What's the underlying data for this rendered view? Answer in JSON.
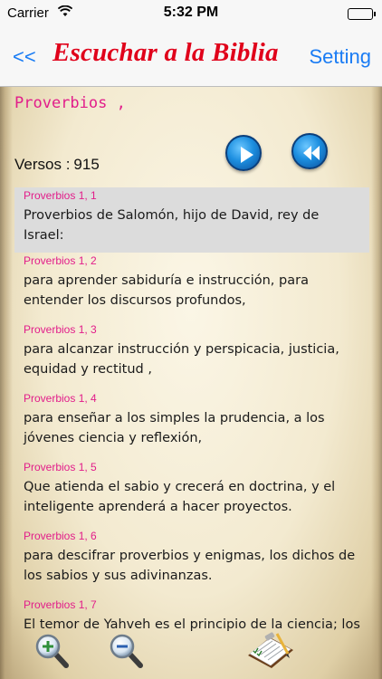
{
  "status_bar": {
    "carrier": "Carrier",
    "wifi_icon": "wifi-icon",
    "time": "5:32 PM",
    "battery_icon": "battery-icon"
  },
  "nav": {
    "back_label": "<<",
    "title": "Escuchar a la Biblia",
    "setting_label": "Setting"
  },
  "colors": {
    "accent_blue": "#1a7cf4",
    "title_red": "#e0001a",
    "reference_pink": "#e21d8a"
  },
  "book_title": "Proverbios ,",
  "versos": {
    "label": "Versos :",
    "count": "915"
  },
  "controls": {
    "play_icon": "play-icon",
    "rewind_icon": "rewind-icon"
  },
  "verses": [
    {
      "ref": "Proverbios 1, 1",
      "text": "Proverbios de Salomón, hijo de David, rey de Israel:",
      "selected": true
    },
    {
      "ref": "Proverbios 1, 2",
      "text": "para aprender sabiduría e instrucción, para entender los discursos profundos,"
    },
    {
      "ref": "Proverbios 1, 3",
      "text": "para alcanzar instrucción y perspicacia,  justicia, equidad y rectitud ,"
    },
    {
      "ref": "Proverbios 1, 4",
      "text": "para enseñar a los simples la prudencia, a los jóvenes ciencia y reflexión,"
    },
    {
      "ref": "Proverbios 1, 5",
      "text": "Que atienda el sabio y crecerá en doctrina, y el inteligente aprenderá a hacer proyectos."
    },
    {
      "ref": "Proverbios 1, 6",
      "text": "para descifrar proverbios y enigmas, los dichos de los sabios y sus adivinanzas."
    },
    {
      "ref": "Proverbios 1, 7",
      "text": "El temor de Yahveh es el principio de la ciencia; los"
    }
  ],
  "toolbar": {
    "zoom_in_icon": "zoom-in-icon",
    "zoom_out_icon": "zoom-out-icon",
    "notes_icon": "clipboard-notes-icon"
  }
}
